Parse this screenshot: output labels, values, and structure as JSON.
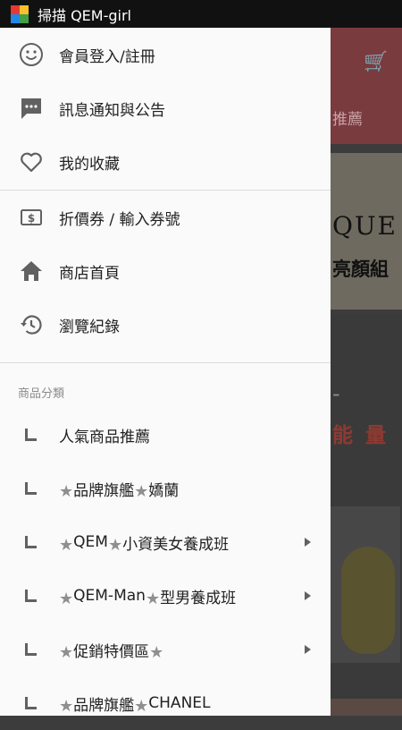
{
  "status_bar": {
    "title": "掃描 QEM-girl",
    "app_icon": "multicolor-app-icon"
  },
  "drawer": {
    "menu": [
      {
        "label": "會員登入/註冊",
        "icon": "smiley-face-icon"
      },
      {
        "label": "訊息通知與公告",
        "icon": "chat-bubble-icon"
      },
      {
        "label": "我的收藏",
        "icon": "heart-outline-icon"
      },
      {
        "label": "折價券 / 輸入券號",
        "icon": "coupon-icon"
      },
      {
        "label": "商店首頁",
        "icon": "home-icon"
      },
      {
        "label": "瀏覽紀錄",
        "icon": "history-icon"
      }
    ],
    "section_title": "商品分類",
    "categories": [
      {
        "prefix": "",
        "name": "人氣商品推薦",
        "suffix": "",
        "has_submenu": false
      },
      {
        "prefix": "★",
        "name": "品牌旗艦",
        "mid_star": "★",
        "tail": "嬌蘭",
        "suffix": "",
        "has_submenu": false
      },
      {
        "prefix": "★",
        "name": "QEM",
        "mid_star": "★",
        "tail": "小資美女養成班",
        "suffix": "",
        "has_submenu": true
      },
      {
        "prefix": "★",
        "name": "QEM-Man",
        "mid_star": "★",
        "tail": "型男養成班",
        "suffix": "",
        "has_submenu": true
      },
      {
        "prefix": "★",
        "name": "促銷特價區",
        "mid_star": "",
        "tail": "",
        "suffix": "★",
        "has_submenu": true
      },
      {
        "prefix": "★",
        "name": "品牌旗艦",
        "mid_star": "★",
        "tail": "CHANEL",
        "suffix": "",
        "has_submenu": false
      }
    ]
  },
  "background": {
    "tab_text": "推薦",
    "banner_text_1": "QUE",
    "banner_text_2": "亮顏組",
    "banner_dash": "-",
    "banner_text_3": "能 量"
  },
  "colors": {
    "drawer_bg": "#fafafa",
    "icon_gray": "#616161",
    "header_band": "#7a3b3f"
  }
}
